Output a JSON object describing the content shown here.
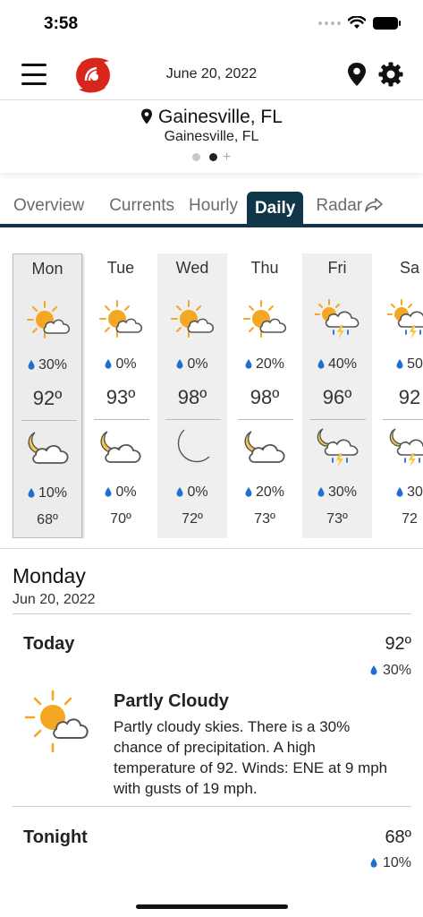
{
  "status": {
    "time": "3:58"
  },
  "header": {
    "date": "June 20, 2022"
  },
  "location": {
    "name": "Gainesville, FL",
    "subtitle": "Gainesville, FL"
  },
  "tabs": [
    {
      "label": "Overview",
      "active": false
    },
    {
      "label": "Currents",
      "active": false
    },
    {
      "label": "Hourly",
      "active": false
    },
    {
      "label": "Daily",
      "active": true
    },
    {
      "label": "Radar",
      "active": false
    }
  ],
  "days": [
    {
      "name": "Mon",
      "day_icon": "partly-cloudy-day-icon",
      "day_precip": "30%",
      "high": "92º",
      "night_icon": "partly-cloudy-night-icon",
      "night_precip": "10%",
      "low": "68º"
    },
    {
      "name": "Tue",
      "day_icon": "partly-cloudy-day-icon",
      "day_precip": "0%",
      "high": "93º",
      "night_icon": "partly-cloudy-night-icon",
      "night_precip": "0%",
      "low": "70º"
    },
    {
      "name": "Wed",
      "day_icon": "partly-cloudy-day-icon",
      "day_precip": "0%",
      "high": "98º",
      "night_icon": "moon-icon",
      "night_precip": "0%",
      "low": "72º"
    },
    {
      "name": "Thu",
      "day_icon": "partly-cloudy-day-icon",
      "day_precip": "20%",
      "high": "98º",
      "night_icon": "partly-cloudy-night-icon",
      "night_precip": "20%",
      "low": "73º"
    },
    {
      "name": "Fri",
      "day_icon": "thunderstorm-day-icon",
      "day_precip": "40%",
      "high": "96º",
      "night_icon": "thunderstorm-night-icon",
      "night_precip": "30%",
      "low": "73º"
    },
    {
      "name": "Sa",
      "day_icon": "thunderstorm-day-icon",
      "day_precip": "50",
      "high": "92",
      "night_icon": "thunderstorm-night-icon",
      "night_precip": "30",
      "low": "72"
    }
  ],
  "detail": {
    "day": "Monday",
    "date": "Jun 20, 2022",
    "today": {
      "label": "Today",
      "temp": "92º",
      "precip": "30%",
      "condition": "Partly Cloudy",
      "description": "Partly cloudy skies. There is a 30% chance of precipitation.  A high temperature of 92.  Winds: ENE at 9 mph with gusts of 19 mph."
    },
    "tonight": {
      "label": "Tonight",
      "temp": "68º",
      "precip": "10%"
    }
  },
  "colors": {
    "accent": "#11364a",
    "sun": "#f5a623",
    "drop": "#1f6fd0",
    "logo": "#d8261c"
  }
}
